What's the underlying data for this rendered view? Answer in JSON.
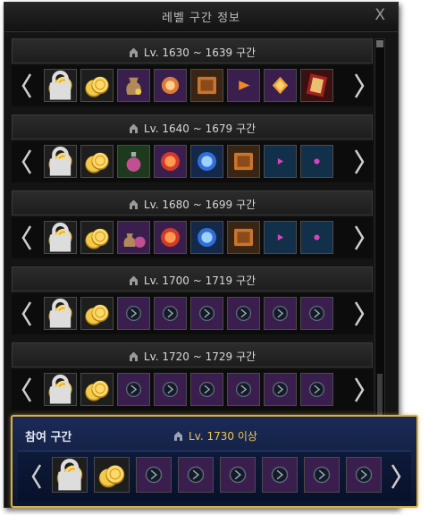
{
  "window": {
    "title": "레벨 구간 정보",
    "close_label": "X"
  },
  "sections": [
    {
      "label": "Lv. 1630 ~ 1639 구간",
      "items": [
        "gold-coins-locked",
        "gold-coins",
        "treasure-pouch",
        "magic-orb",
        "spell-tome",
        "orange-shard",
        "amber-gem",
        "red-scroll"
      ]
    },
    {
      "label": "Lv. 1640 ~ 1679 구간",
      "items": [
        "gold-coins-locked",
        "gold-coins",
        "potion-bottle",
        "red-crystal-orb",
        "blue-crystal-orb",
        "spell-tome",
        "pink-shard",
        "pink-gem"
      ]
    },
    {
      "label": "Lv. 1680 ~ 1699 구간",
      "items": [
        "gold-coins-locked",
        "gold-coins",
        "pouch-and-bottle",
        "red-crystal-orb",
        "blue-crystal-orb",
        "spell-tome",
        "pink-shard",
        "pink-gem"
      ]
    },
    {
      "label": "Lv. 1700 ~ 1719 구간",
      "items": [
        "gold-coins-locked",
        "gold-coins",
        "rune-stone-1",
        "rune-stone-2",
        "rune-stone-3",
        "rune-stone-4",
        "rune-stone-5",
        "rune-stone-6"
      ]
    },
    {
      "label": "Lv. 1720 ~ 1729 구간",
      "items": [
        "gold-coins-locked",
        "gold-coins",
        "rune-stone-1",
        "rune-stone-2",
        "rune-stone-3",
        "rune-stone-4",
        "rune-stone-5",
        "rune-stone-6"
      ]
    }
  ],
  "participation": {
    "label": "참여 구간",
    "range": "Lv. 1730 이상",
    "items": [
      "gold-coins-locked",
      "gold-coins",
      "rune-stone-1",
      "rune-stone-2",
      "rune-stone-3",
      "rune-stone-4",
      "rune-stone-5",
      "rune-stone-6"
    ]
  },
  "colors": {
    "accent_gold": "#d6b04a",
    "range_text": "#f0c94b",
    "slot_purple": "#3a1f4e",
    "slot_blue": "#13304a"
  }
}
